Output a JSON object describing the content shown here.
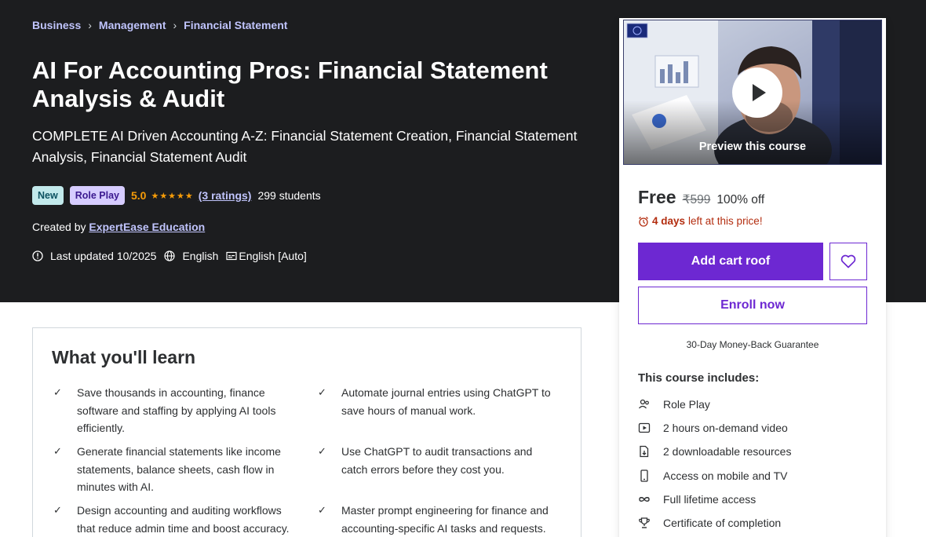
{
  "breadcrumb": [
    "Business",
    "Management",
    "Financial Statement"
  ],
  "course": {
    "title": "AI For Accounting Pros: Financial Statement Analysis & Audit",
    "subtitle": "COMPLETE AI Driven Accounting A-Z: Financial Statement Creation, Financial Statement Analysis, Financial Statement Audit",
    "badge_new": "New",
    "badge_role": "Role Play",
    "rating": "5.0",
    "stars": "★★★★★",
    "ratings_link": "(3 ratings)",
    "students": "299 students",
    "created_by_label": "Created by",
    "author": "ExpertEase Education",
    "last_updated": "Last updated 10/2025",
    "language": "English",
    "captions": "English [Auto]"
  },
  "learn": {
    "heading": "What you'll learn",
    "items": [
      "Save thousands in accounting, finance software and staffing by applying AI tools efficiently.",
      "Automate journal entries using ChatGPT to save hours of manual work.",
      "Generate financial statements like income statements, balance sheets, cash flow in minutes with AI.",
      "Use ChatGPT to audit transactions and catch errors before they cost you.",
      "Design accounting and auditing workflows that reduce admin time and boost accuracy.",
      "Master prompt engineering for finance and accounting-specific AI tasks and requests."
    ]
  },
  "card": {
    "preview_label": "Preview this course",
    "price": "Free",
    "original_price": "₹599",
    "discount": "100% off",
    "timer_days": "4 days",
    "timer_rest": "left at this price!",
    "add_cart": "Add cart roof",
    "enroll": "Enroll now",
    "guarantee": "30-Day Money-Back Guarantee",
    "includes_title": "This course includes:",
    "includes": [
      {
        "icon": "role-play-icon",
        "label": "Role Play"
      },
      {
        "icon": "video-icon",
        "label": "2 hours on-demand video"
      },
      {
        "icon": "download-icon",
        "label": "2 downloadable resources"
      },
      {
        "icon": "mobile-icon",
        "label": "Access on mobile and TV"
      },
      {
        "icon": "infinity-icon",
        "label": "Full lifetime access"
      },
      {
        "icon": "trophy-icon",
        "label": "Certificate of completion"
      }
    ]
  },
  "colors": {
    "hero_bg": "#1c1d1f",
    "accent": "#6d28d2",
    "link": "#c0c4fc",
    "star": "#f69c08",
    "timer": "#b32d0f"
  }
}
